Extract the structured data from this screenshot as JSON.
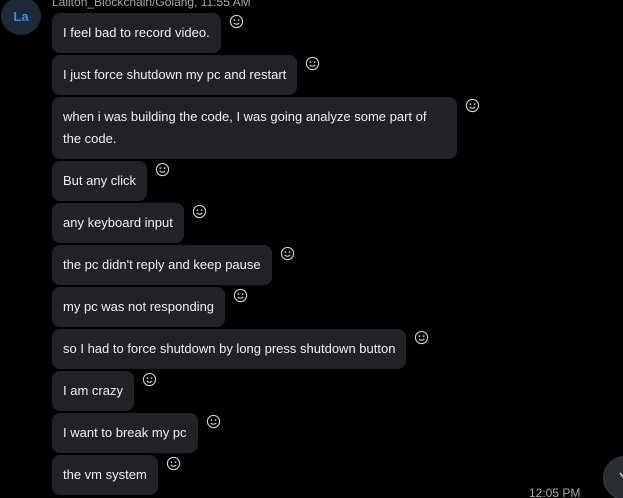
{
  "avatar": {
    "initials": "La"
  },
  "sender": {
    "line": "Lailton_Blockchain/Golang, 11:55 AM"
  },
  "messages": [
    {
      "text": "I feel bad to record video."
    },
    {
      "text": "I just force shutdown my pc and restart"
    },
    {
      "text": "when i was building the code, I was going analyze some part of the code."
    },
    {
      "text": "But any click"
    },
    {
      "text": "any keyboard input"
    },
    {
      "text": "the pc didn't reply and keep pause"
    },
    {
      "text": "my pc was not responding"
    },
    {
      "text": "so I had to force shutdown by long press shutdown button"
    },
    {
      "text": "I am crazy"
    },
    {
      "text": "I want to break my pc"
    },
    {
      "text": "the vm system"
    }
  ],
  "footer": {
    "time": "12:05 PM"
  },
  "icons": {
    "reaction": "smiley-icon",
    "scroll": "chevron-down-icon"
  },
  "colors": {
    "background": "#000000",
    "bubble": "#202225",
    "avatar_text": "#2f8df5"
  }
}
